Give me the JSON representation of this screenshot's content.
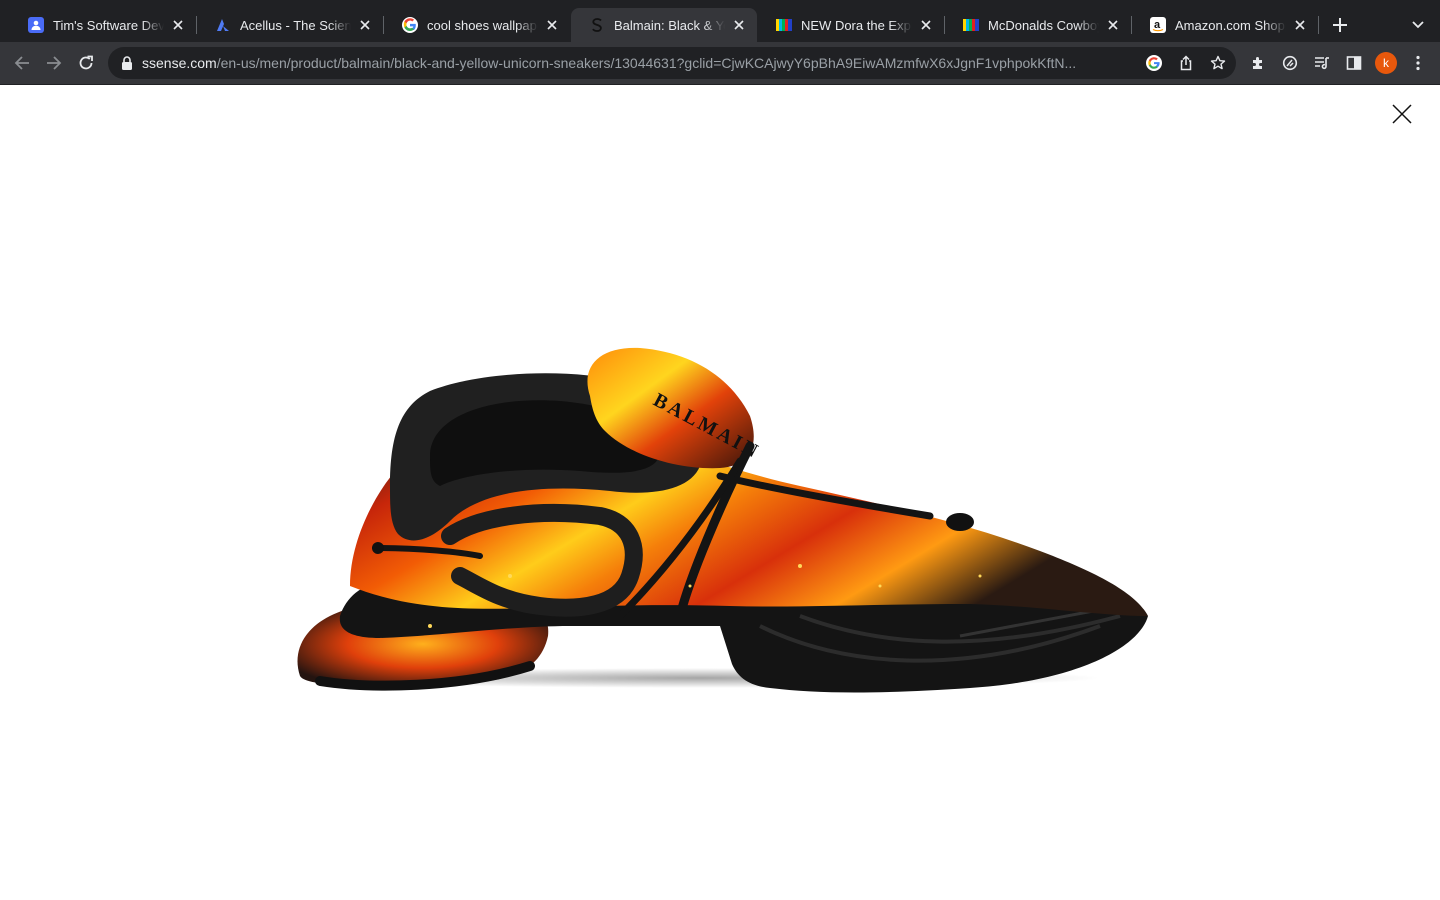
{
  "browser": {
    "tabs": [
      {
        "title": "Tim's Software Devel",
        "favicon": "google-meet-icon",
        "active": false
      },
      {
        "title": "Acellus - The Science",
        "favicon": "acellus-icon",
        "active": false
      },
      {
        "title": "cool shoes wallpaper",
        "favicon": "google-icon",
        "active": false
      },
      {
        "title": "Balmain: Black & Yell",
        "favicon": "ssense-icon",
        "active": true
      },
      {
        "title": "NEW Dora the Explor",
        "favicon": "tv-bars-icon",
        "active": false
      },
      {
        "title": "McDonalds Cowboy I",
        "favicon": "tv-bars-icon",
        "active": false
      },
      {
        "title": "Amazon.com Shoppi",
        "favicon": "amazon-icon",
        "active": false
      }
    ],
    "url_host": "ssense.com",
    "url_path": "/en-us/men/product/balmain/black-and-yellow-unicorn-sneakers/13044631?gclid=CjwKCAjwyY6pBhA9EiwAMzmfwX6xJgnF1vphpokKftN...",
    "profile_initial": "k"
  },
  "page": {
    "product_image_alt": "Balmain Black & Yellow Unicorn Sneakers",
    "logo_text": "BALMAIN"
  },
  "colors": {
    "tabstrip_bg": "#202124",
    "toolbar_bg": "#35363a",
    "avatar_bg": "#e8580c",
    "flame_orange": "#f25c05",
    "flame_yellow": "#ffcc1a",
    "shoe_black": "#1b1b1b"
  }
}
